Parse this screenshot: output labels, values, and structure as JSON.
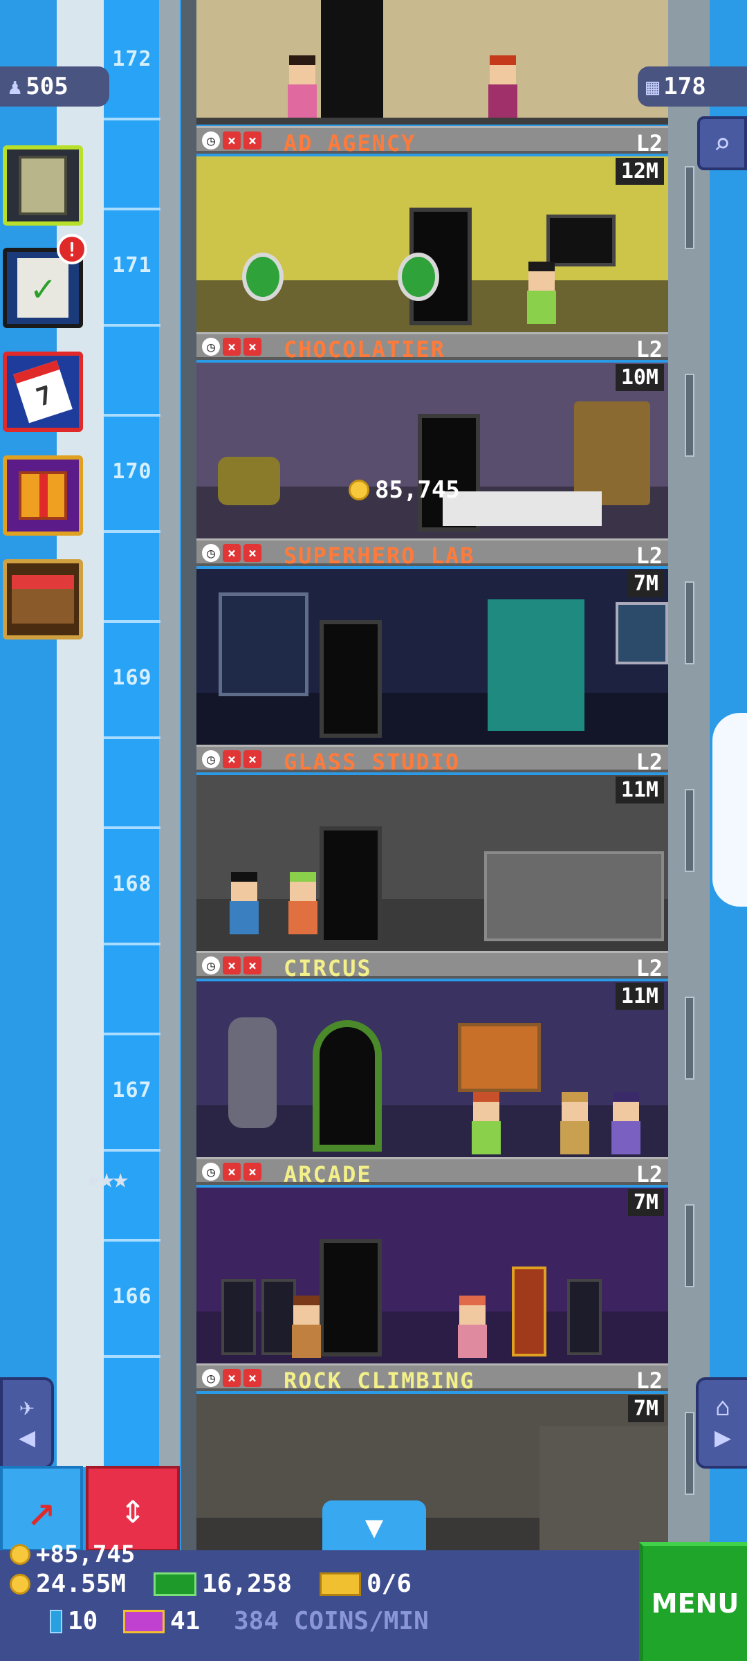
{
  "tower": {
    "population": "505",
    "floor_count": "178",
    "floor_numbers": [
      "172",
      "171",
      "170",
      "169",
      "168",
      "167",
      "166"
    ]
  },
  "floors": [
    {
      "name": "AD AGENCY",
      "level": "L2",
      "stock": "12M",
      "name_color": "#ff7b3b",
      "bg": "#6b6330",
      "wall": "#cdc44a"
    },
    {
      "name": "CHOCOLATIER",
      "level": "L2",
      "stock": "10M",
      "name_color": "#ff7b3b",
      "bg": "#3b3448",
      "wall": "#5a4e6e"
    },
    {
      "name": "SUPERHERO LAB",
      "level": "L2",
      "stock": "7M",
      "name_color": "#ff7b3b",
      "bg": "#121628",
      "wall": "#1c2240"
    },
    {
      "name": "GLASS STUDIO",
      "level": "L2",
      "stock": "11M",
      "name_color": "#ff7b3b",
      "bg": "#3a3a3a",
      "wall": "#4d4d4d"
    },
    {
      "name": "CIRCUS",
      "level": "L2",
      "stock": "11M",
      "name_color": "#f3f089",
      "bg": "#2a2545",
      "wall": "#3a3260"
    },
    {
      "name": "ARCADE",
      "level": "L2",
      "stock": "7M",
      "name_color": "#f3f089",
      "bg": "#2b1d45",
      "wall": "#3d2460"
    },
    {
      "name": "ROCK CLIMBING",
      "level": "L2",
      "stock": "7M",
      "name_color": "#f3f089",
      "bg": "#3a3836",
      "wall": "#54504a"
    }
  ],
  "floating_coin": "85,745",
  "stars_count": 3,
  "status": {
    "coins_gain": "+85,745",
    "coins": "24.55M",
    "bux": "16,258",
    "tickets": "0/6",
    "gems": "10",
    "vip": "41",
    "rate": "384 COINS/MIN",
    "menu": "MENU"
  },
  "side_buttons": [
    {
      "name": "build-floors",
      "color": "#2a2f3a"
    },
    {
      "name": "missions",
      "color": "#1a1a1a",
      "badge": "!"
    },
    {
      "name": "calendar",
      "color": "#1d3c9c",
      "label": "7"
    },
    {
      "name": "gift",
      "color": "#5b1c8a"
    },
    {
      "name": "market",
      "color": "#4a2d10"
    }
  ],
  "colors": {
    "sky": "#2b9be8",
    "shaft": "#29a3f5",
    "menu_green": "#1fa62a",
    "bar_blue": "#3e4d8e",
    "raise_red": "#e8304a"
  }
}
